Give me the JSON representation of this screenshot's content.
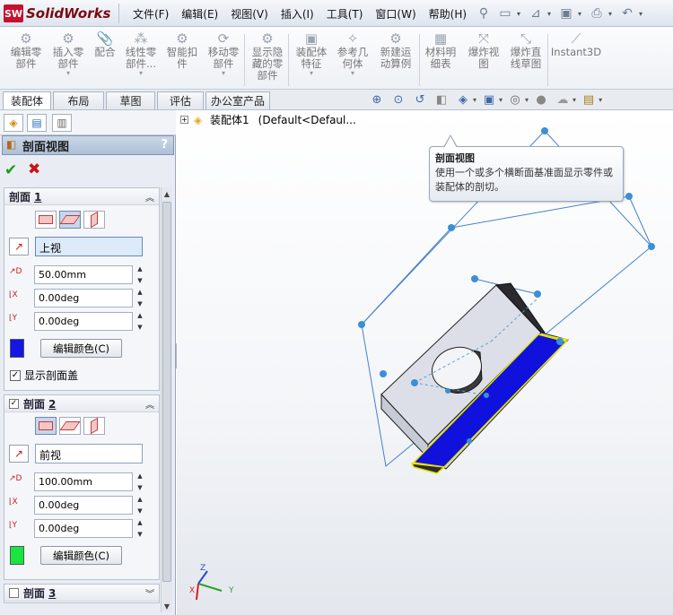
{
  "app": {
    "logo_mark": "SW",
    "logo_text": "SolidWorks"
  },
  "menu": [
    "文件(F)",
    "编辑(E)",
    "视图(V)",
    "插入(I)",
    "工具(T)",
    "窗口(W)",
    "帮助(H)"
  ],
  "ribbon": [
    {
      "label1": "编辑零",
      "label2": "部件",
      "caret": false
    },
    {
      "label1": "插入零",
      "label2": "部件",
      "caret": true
    },
    {
      "label1": "配合",
      "label2": "",
      "caret": false
    },
    {
      "label1": "线性零",
      "label2": "部件...",
      "caret": true
    },
    {
      "label1": "智能扣",
      "label2": "件",
      "caret": false
    },
    {
      "label1": "移动零",
      "label2": "部件",
      "caret": true
    },
    {
      "label1": "显示隐",
      "label2": "藏的零",
      "label3": "部件",
      "caret": false
    },
    {
      "label1": "装配体",
      "label2": "特征",
      "caret": true
    },
    {
      "label1": "参考几",
      "label2": "何体",
      "caret": true
    },
    {
      "label1": "新建运",
      "label2": "动算例",
      "caret": false
    },
    {
      "label1": "材料明",
      "label2": "细表",
      "caret": false
    },
    {
      "label1": "爆炸视",
      "label2": "图",
      "caret": false
    },
    {
      "label1": "爆炸直",
      "label2": "线草图",
      "caret": false
    },
    {
      "label1": "Instant3D",
      "label2": "",
      "caret": false
    }
  ],
  "tabs": [
    "装配体",
    "布局",
    "草图",
    "评估",
    "办公室产品"
  ],
  "property_manager": {
    "title": "剖面视图",
    "help": "?",
    "section1": {
      "title": "剖面",
      "num": "1",
      "reference": "上视",
      "distance": "50.00mm",
      "angle_x": "0.00deg",
      "angle_y": "0.00deg",
      "color": "#1515e6",
      "edit_color_label": "编辑颜色(C)",
      "show_cap_label": "显示剖面盖",
      "show_cap_checked": true
    },
    "section2": {
      "title": "剖面",
      "num": "2",
      "enabled": true,
      "reference": "前视",
      "distance": "100.00mm",
      "angle_x": "0.00deg",
      "angle_y": "0.00deg",
      "color": "#18e63c",
      "edit_color_label": "编辑颜色(C)"
    },
    "section3": {
      "title": "剖面",
      "num": "3",
      "enabled": false
    }
  },
  "tree": {
    "root": "装配体1",
    "config": "(Default<Defaul..."
  },
  "tooltip": {
    "title": "剖面视图",
    "body": "使用一个或多个横断面基准面显示零件或装配体的剖切。"
  },
  "triad": {
    "x": "X",
    "y": "Y",
    "z": "Z"
  },
  "colors": {
    "section_fill": "#1111dd",
    "outline": "#e6e600",
    "handle": "#3a8fd8",
    "plane": "#4a7fc8"
  }
}
